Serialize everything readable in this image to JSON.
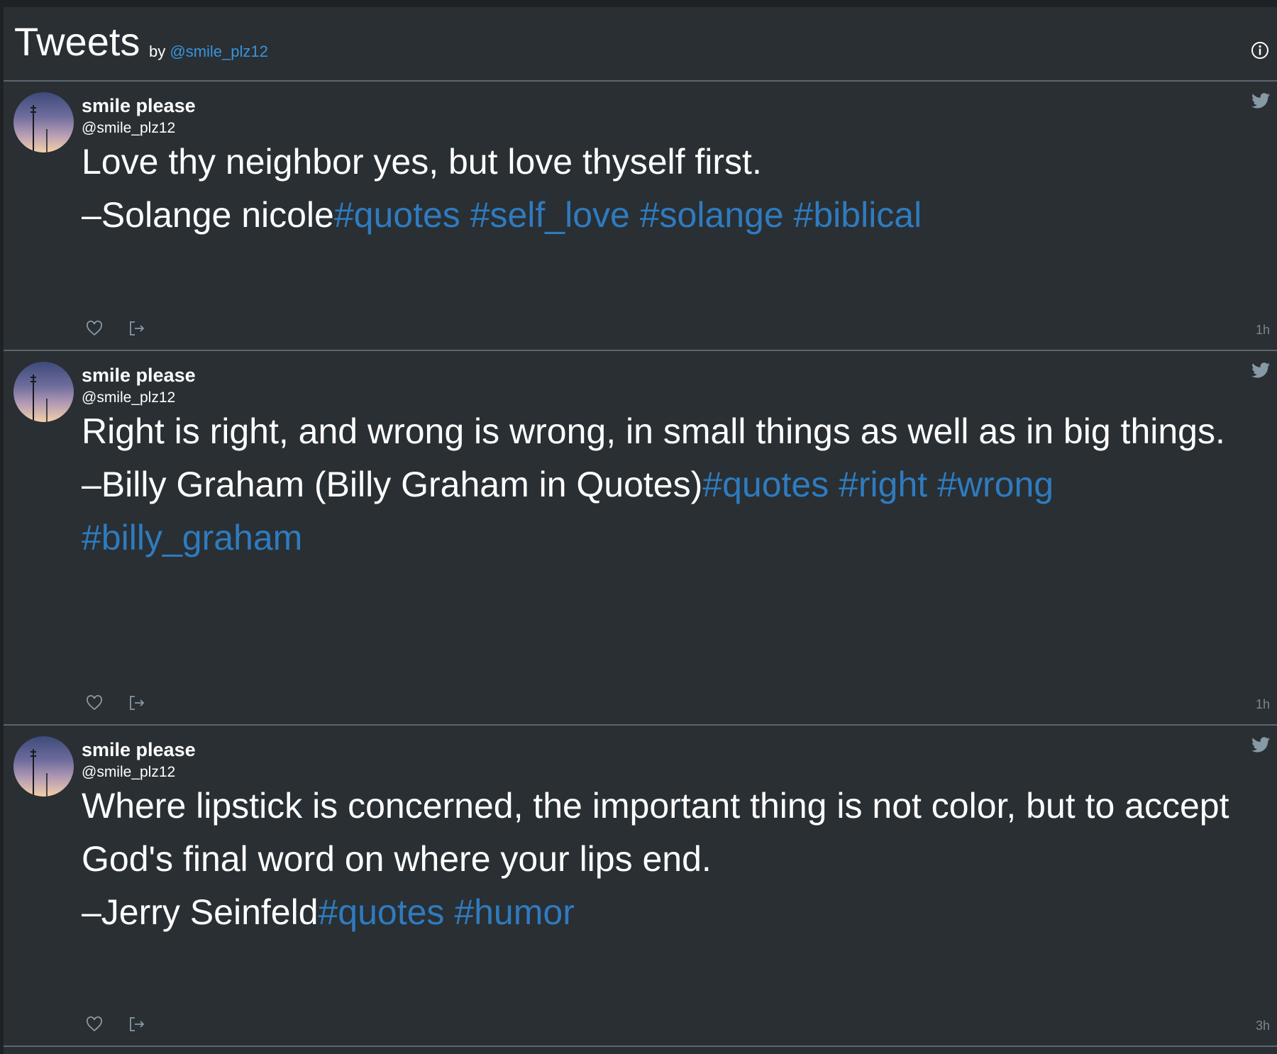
{
  "header": {
    "title": "Tweets",
    "by_prefix": "by",
    "by_handle": "@smile_plz12"
  },
  "tweets": [
    {
      "name": "smile please",
      "handle": "@smile_plz12",
      "text": "Love thy neighbor yes, but love thyself first.\n–Solange nicole",
      "hashtags": "#quotes #self_love #solange #biblical",
      "time": "1h"
    },
    {
      "name": "smile please",
      "handle": "@smile_plz12",
      "text": "Right is right, and wrong is wrong, in small things as well as in big things.\n–Billy Graham (Billy Graham in Quotes)",
      "hashtags": "#quotes #right #wrong #billy_graham",
      "time": "1h"
    },
    {
      "name": "smile please",
      "handle": "@smile_plz12",
      "text": "Where lipstick is concerned, the important thing is not color, but to accept God's final word on where your lips end.\n–Jerry Seinfeld",
      "hashtags": "#quotes #humor",
      "time": "3h"
    }
  ],
  "icons": {
    "info": "info-icon",
    "bird": "twitter-bird-icon",
    "like": "heart-icon",
    "share": "share-icon"
  },
  "colors": {
    "background": "#292f33",
    "link": "#3b94d9",
    "hashtag": "#2f7bbf",
    "divider": "#5c6570",
    "muted": "#7c8790"
  }
}
